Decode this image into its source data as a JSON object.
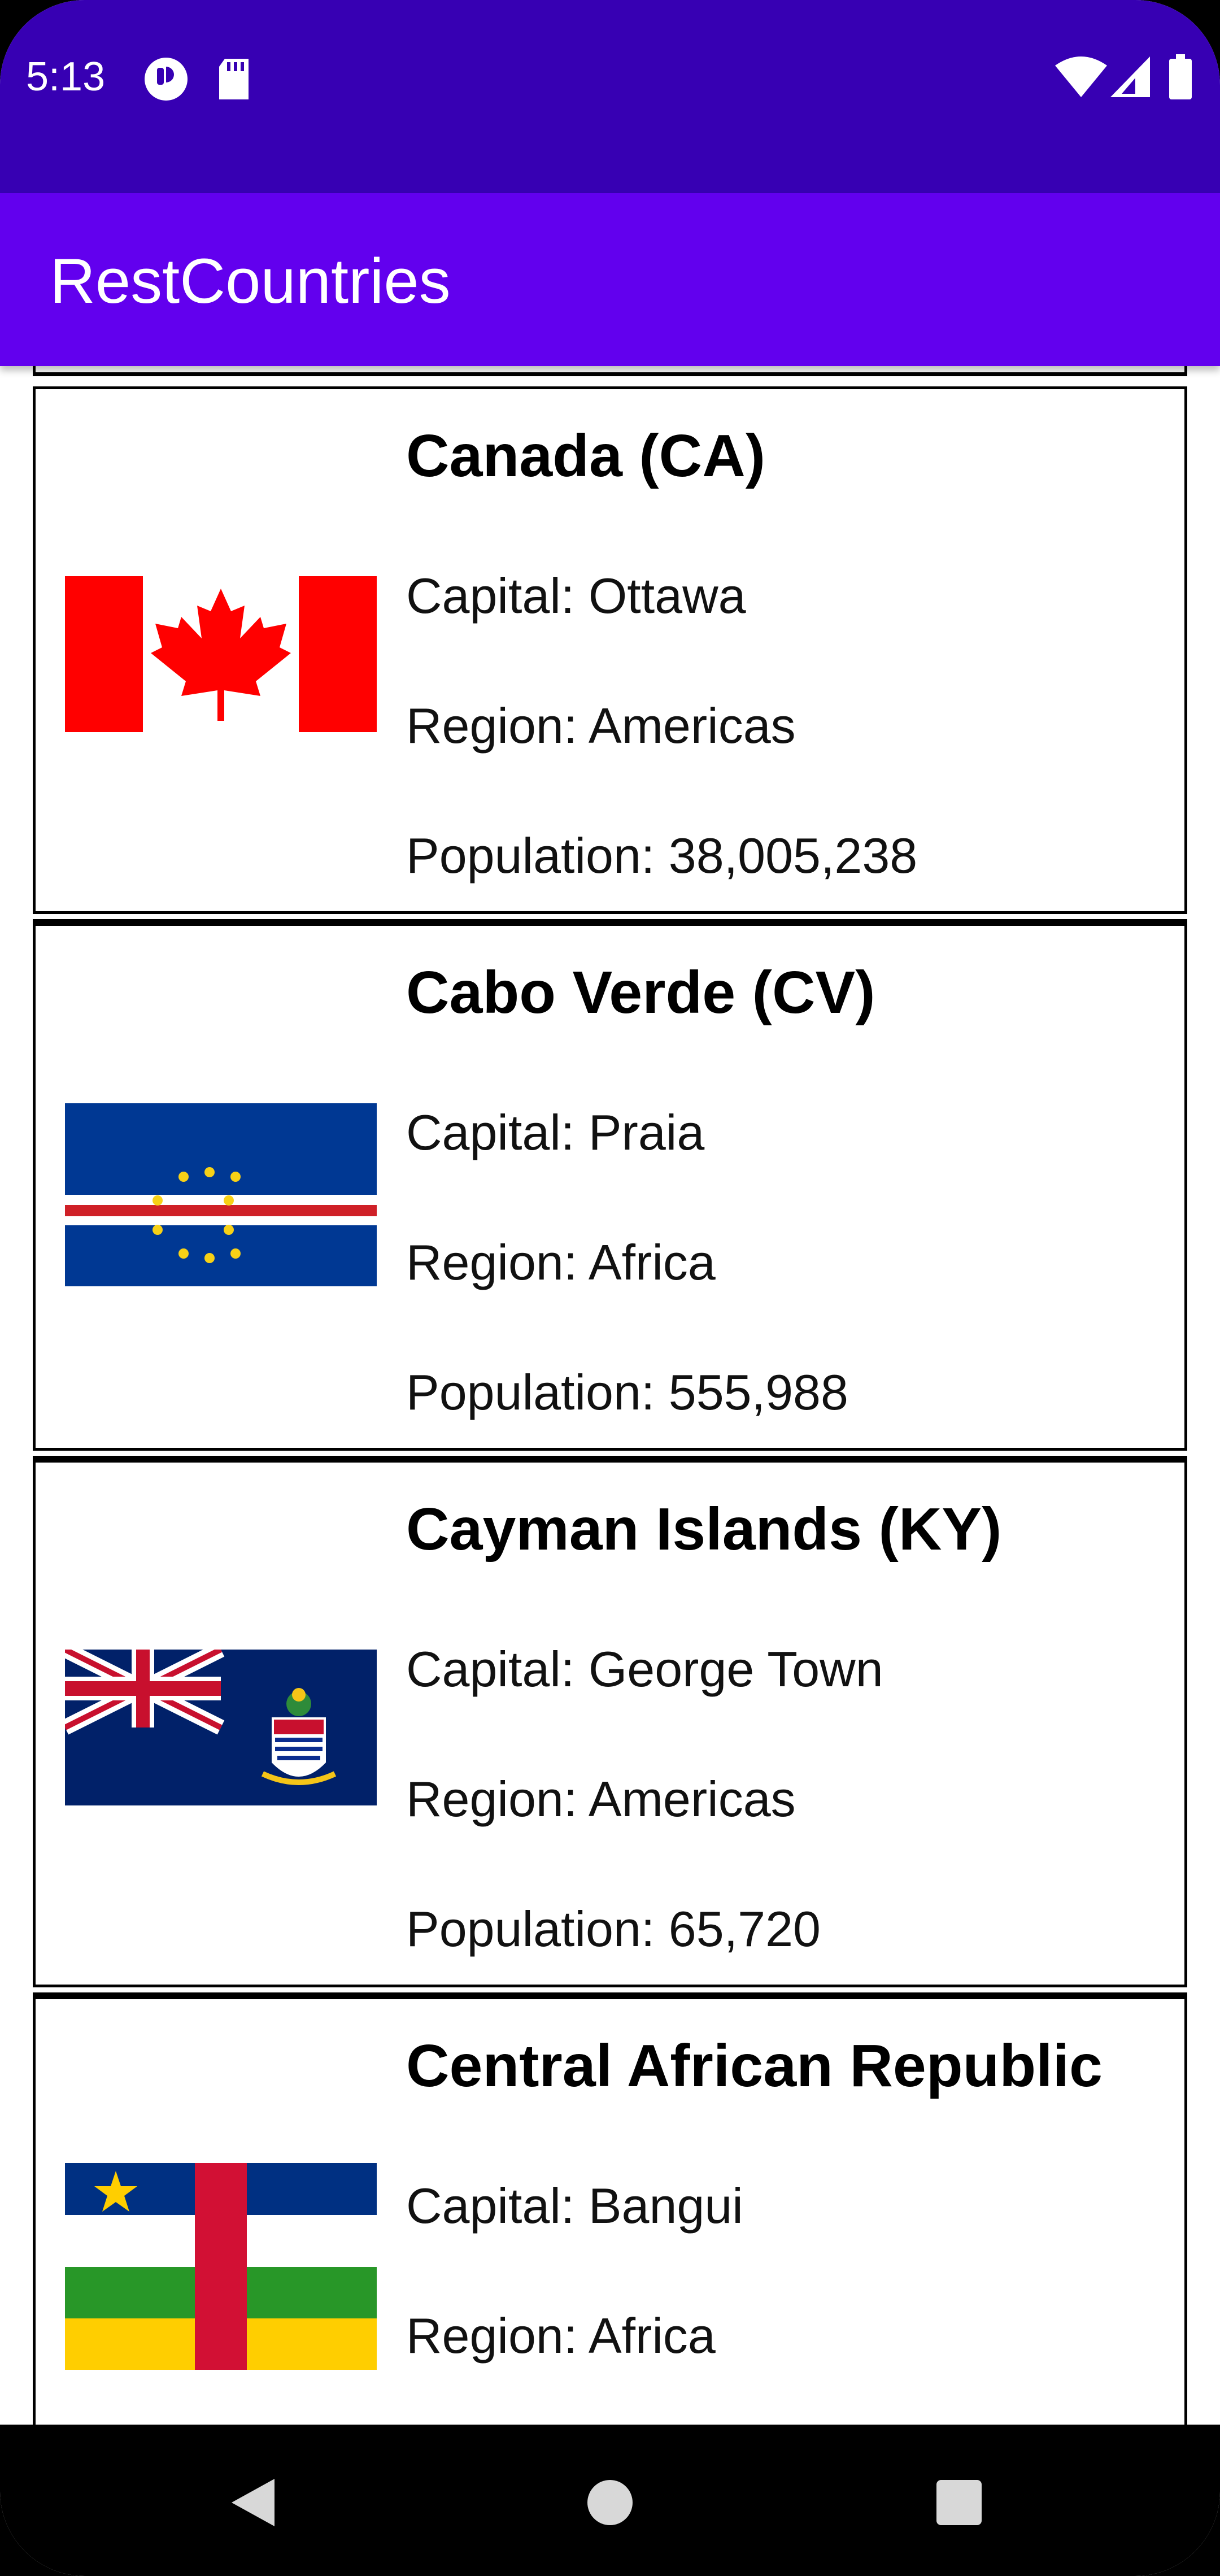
{
  "status_bar": {
    "time": "5:13",
    "icons": [
      "notification-app-icon",
      "sd-card-icon",
      "wifi-icon",
      "signal-icon",
      "battery-icon"
    ]
  },
  "app_bar": {
    "title": "RestCountries"
  },
  "countries": [
    {
      "name": "Canada (CA)",
      "capital": "Capital: Ottawa",
      "region": "Region: Americas",
      "population": "Population: 38,005,238",
      "flag": "canada-flag"
    },
    {
      "name": "Cabo Verde (CV)",
      "capital": "Capital: Praia",
      "region": "Region: Africa",
      "population": "Population: 555,988",
      "flag": "cabo-verde-flag"
    },
    {
      "name": "Cayman Islands (KY)",
      "capital": "Capital: George Town",
      "region": "Region: Americas",
      "population": "Population: 65,720",
      "flag": "cayman-islands-flag"
    },
    {
      "name": "Central African Republic",
      "capital": "Capital: Bangui",
      "region": "Region: Africa",
      "flag": "central-african-republic-flag"
    }
  ],
  "nav_bar": {
    "buttons": [
      "back-icon",
      "home-icon",
      "recents-icon"
    ]
  },
  "colors": {
    "status_bar": "#3700b3",
    "app_bar": "#6200ee"
  }
}
